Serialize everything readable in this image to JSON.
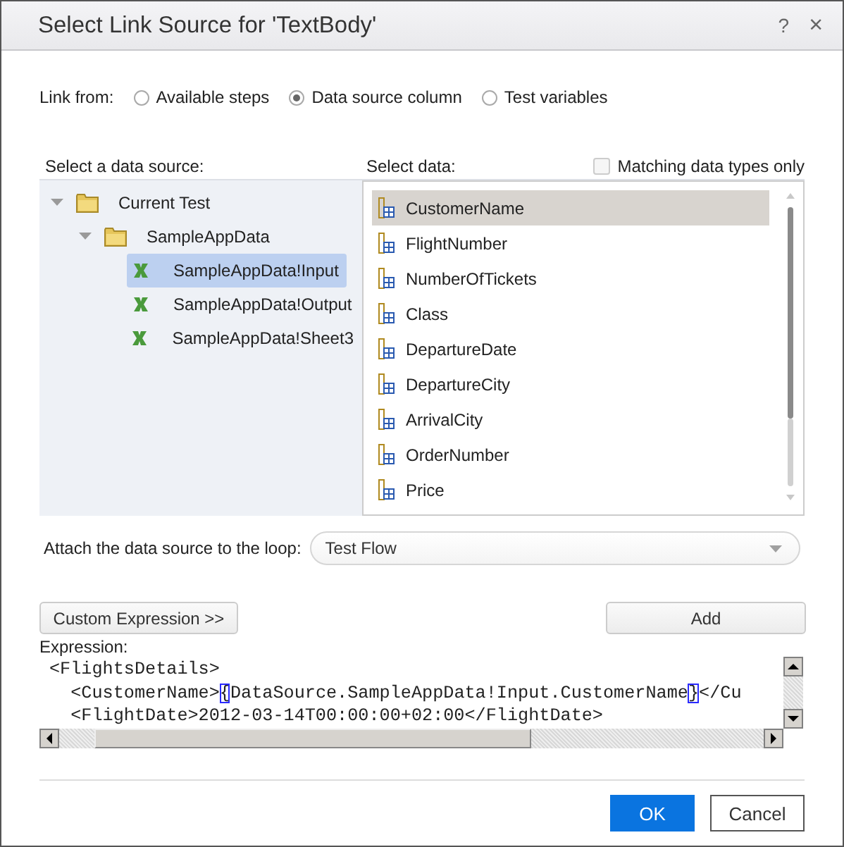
{
  "window": {
    "title": "Select Link Source for 'TextBody'",
    "help": "?",
    "close": "×"
  },
  "link_from": {
    "label": "Link from:",
    "options": [
      {
        "label": "Available steps",
        "selected": false
      },
      {
        "label": "Data source column",
        "selected": true
      },
      {
        "label": "Test variables",
        "selected": false
      }
    ]
  },
  "source_label": "Select a data source:",
  "data_label": "Select data:",
  "matching_types": {
    "label": "Matching data types only",
    "checked": false
  },
  "tree": [
    {
      "label": "Current Test",
      "kind": "folder",
      "expanded": true,
      "selected": false,
      "children": [
        {
          "label": "SampleAppData",
          "kind": "folder",
          "expanded": true,
          "selected": false,
          "children": [
            {
              "label": "SampleAppData!Input",
              "kind": "sheet",
              "selected": true
            },
            {
              "label": "SampleAppData!Output",
              "kind": "sheet",
              "selected": false
            },
            {
              "label": "SampleAppData!Sheet3",
              "kind": "sheet",
              "selected": false
            }
          ]
        }
      ]
    }
  ],
  "columns": [
    {
      "label": "CustomerName",
      "selected": true
    },
    {
      "label": "FlightNumber",
      "selected": false
    },
    {
      "label": "NumberOfTickets",
      "selected": false
    },
    {
      "label": "Class",
      "selected": false
    },
    {
      "label": "DepartureDate",
      "selected": false
    },
    {
      "label": "DepartureCity",
      "selected": false
    },
    {
      "label": "ArrivalCity",
      "selected": false
    },
    {
      "label": "OrderNumber",
      "selected": false
    },
    {
      "label": "Price",
      "selected": false
    }
  ],
  "loop": {
    "label": "Attach the data source to the loop:",
    "value": "Test Flow"
  },
  "custom_expression_button": "Custom Expression >>",
  "add_button": "Add",
  "expression": {
    "label": "Expression:",
    "lines": [
      [
        {
          "text": "<FlightsDetails>",
          "highlight": false
        }
      ],
      [
        {
          "text": "  <CustomerName>",
          "highlight": false
        },
        {
          "text": "{",
          "highlight": true
        },
        {
          "text": "DataSource.SampleAppData!Input.CustomerName",
          "highlight": false
        },
        {
          "text": "}",
          "highlight": true
        },
        {
          "text": "</Cu",
          "highlight": false
        }
      ],
      [
        {
          "text": "  <FlightDate>2012-03-14T00:00:00+02:00</FlightDate>",
          "highlight": false
        }
      ]
    ]
  },
  "buttons": [
    {
      "label": "OK",
      "primary": true
    },
    {
      "label": "Cancel",
      "primary": false
    }
  ]
}
